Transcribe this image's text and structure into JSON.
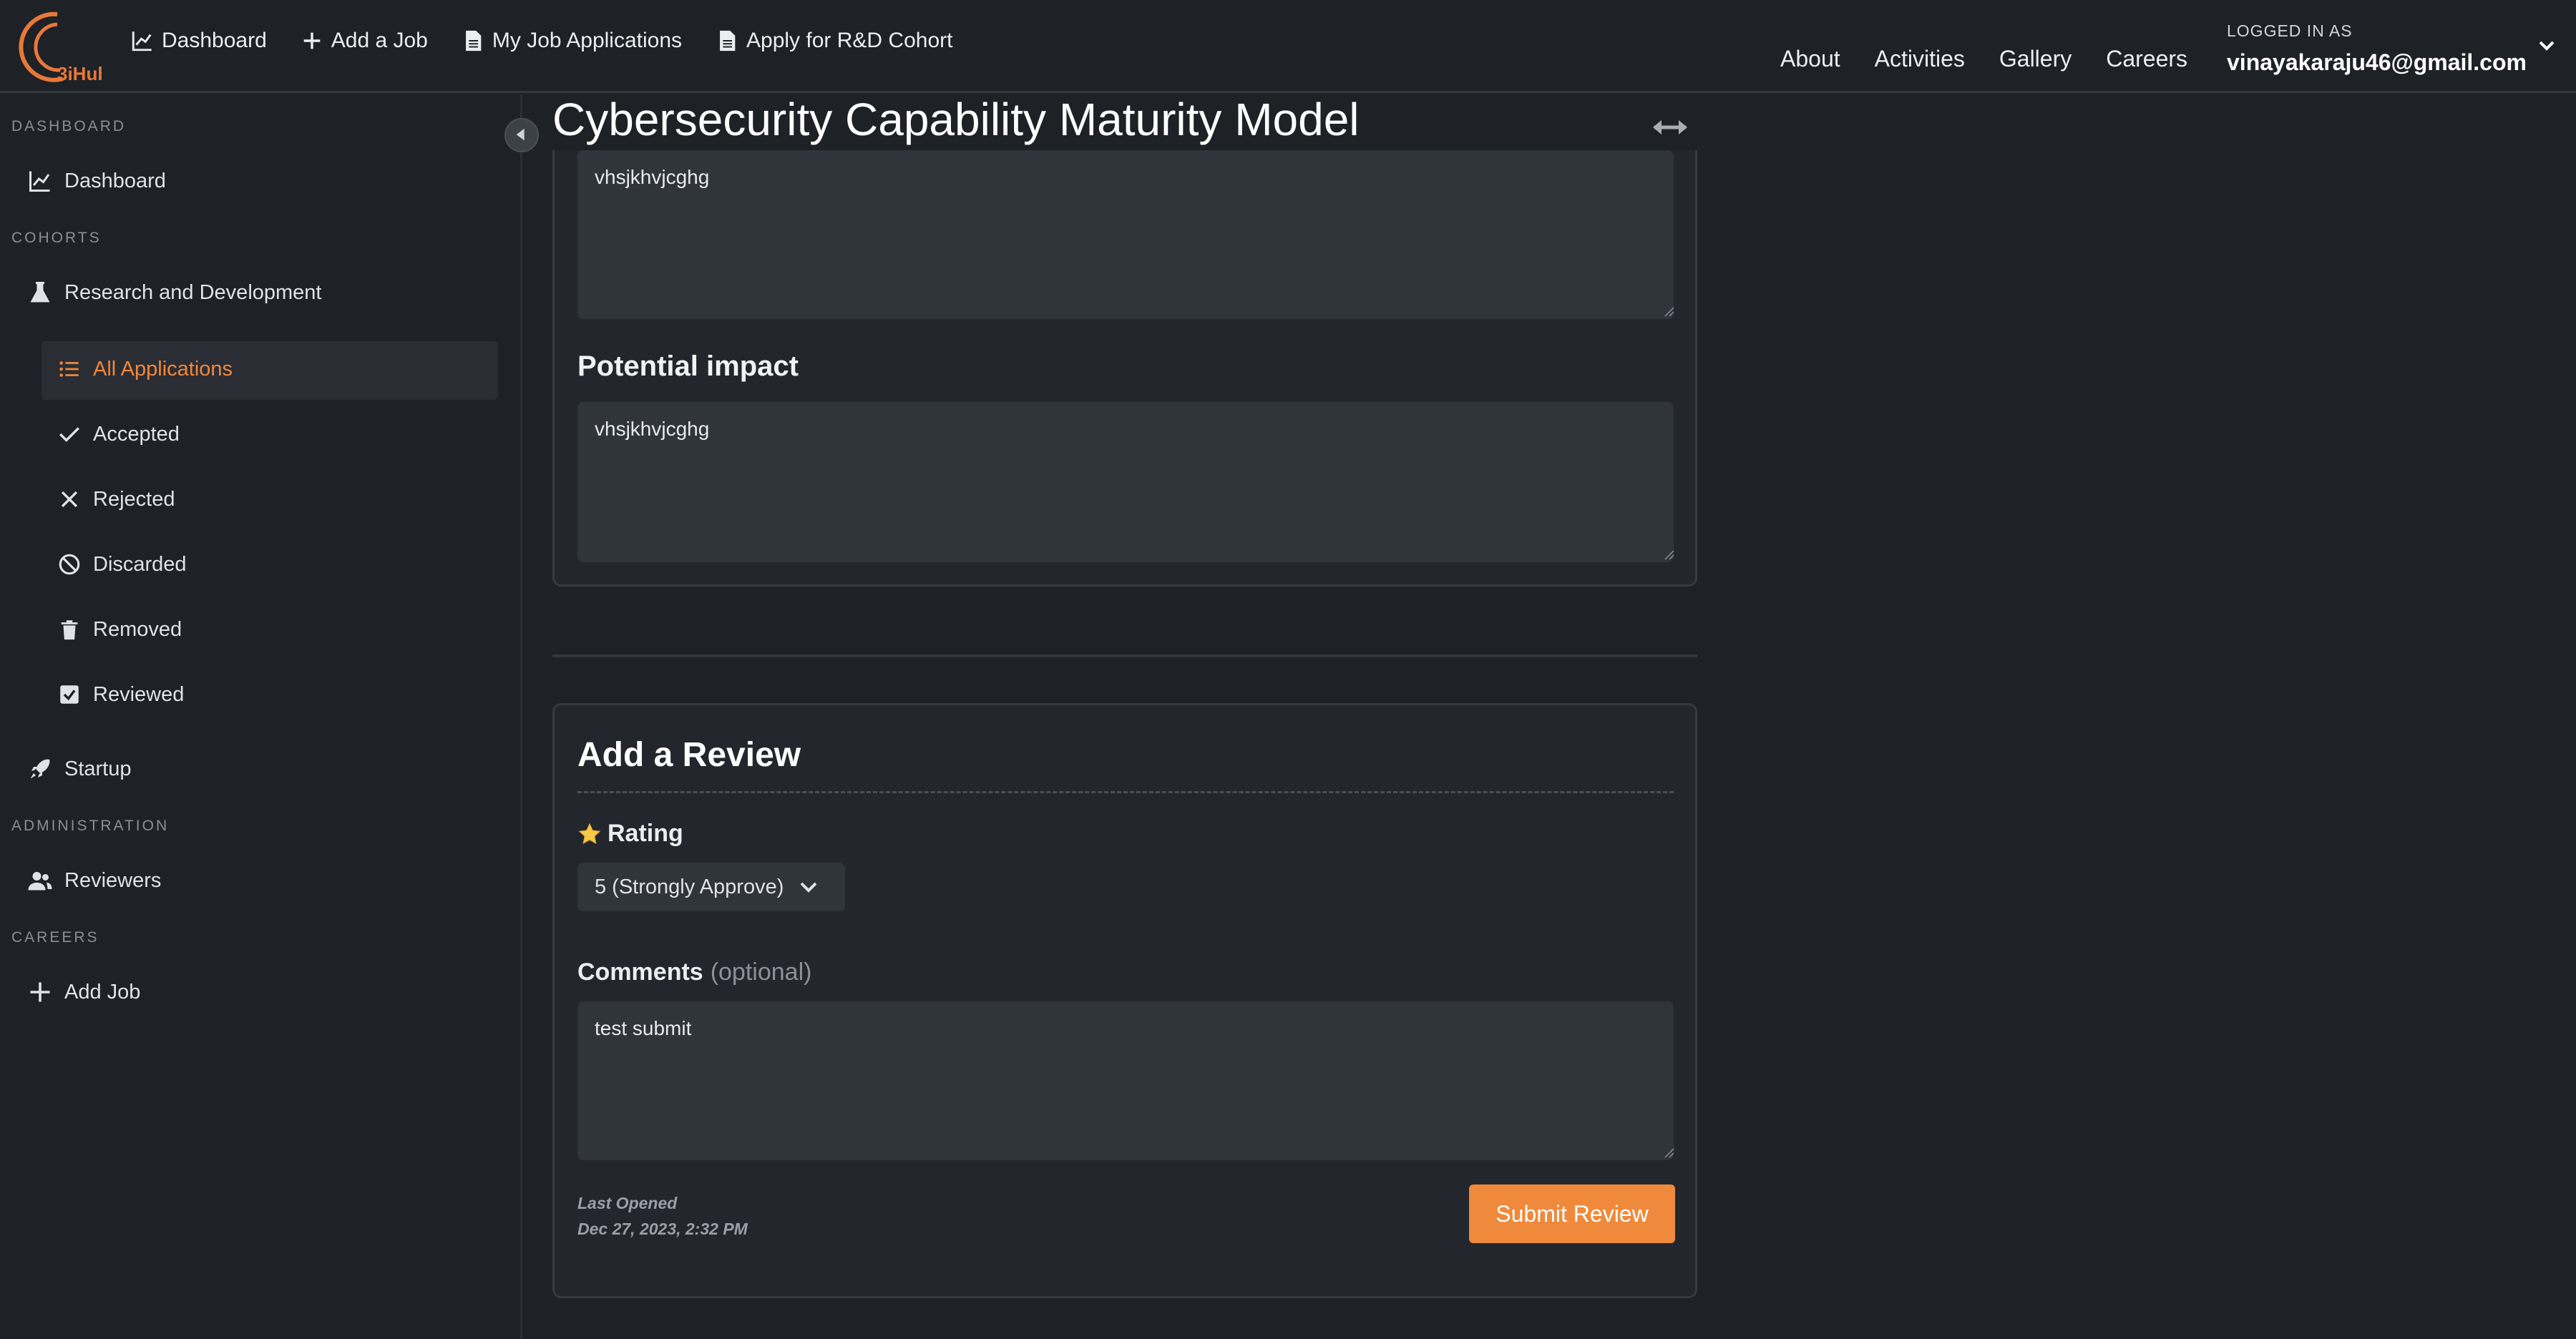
{
  "colors": {
    "accent": "#ef8a3c",
    "background": "#1e2126",
    "card": "#23262c"
  },
  "brand": {
    "logo_text": "3iHub"
  },
  "topnav": {
    "items": [
      {
        "label": "Dashboard",
        "icon": "chart-line-icon"
      },
      {
        "label": "Add a Job",
        "icon": "plus-icon"
      },
      {
        "label": "My Job Applications",
        "icon": "document-icon"
      },
      {
        "label": "Apply for R&D Cohort",
        "icon": "document-icon"
      }
    ],
    "links": [
      "About",
      "Activities",
      "Gallery",
      "Careers"
    ],
    "user_caption": "LOGGED IN AS",
    "user_email": "vinayakaraju46@gmail.com"
  },
  "sidebar": {
    "sections": {
      "dashboard": "DASHBOARD",
      "cohorts": "COHORTS",
      "administration": "ADMINISTRATION",
      "careers": "CAREERS"
    },
    "dashboard_item": "Dashboard",
    "cohort_rd": "Research and Development",
    "rd_subitems": [
      {
        "label": "All Applications",
        "icon": "list-icon",
        "active": true
      },
      {
        "label": "Accepted",
        "icon": "check-icon"
      },
      {
        "label": "Rejected",
        "icon": "x-icon"
      },
      {
        "label": "Discarded",
        "icon": "ban-icon"
      },
      {
        "label": "Removed",
        "icon": "trash-icon"
      },
      {
        "label": "Reviewed",
        "icon": "checkbox-icon"
      }
    ],
    "cohort_startup": "Startup",
    "reviewers": "Reviewers",
    "add_job": "Add Job"
  },
  "main": {
    "title": "Cybersecurity Capability Maturity Model",
    "field1_value": "vhsjkhvjcghg",
    "potential_impact": {
      "heading": "Potential impact",
      "value": "vhsjkhvjcghg"
    },
    "review": {
      "title": "Add a Review",
      "rating_label": "Rating",
      "rating_value": "5 (Strongly Approve)",
      "comments_label": "Comments",
      "comments_optional": "(optional)",
      "comments_value": "test submit",
      "last_opened_label": "Last Opened",
      "last_opened_value": "Dec 27, 2023, 2:32 PM",
      "submit_label": "Submit Review"
    }
  }
}
